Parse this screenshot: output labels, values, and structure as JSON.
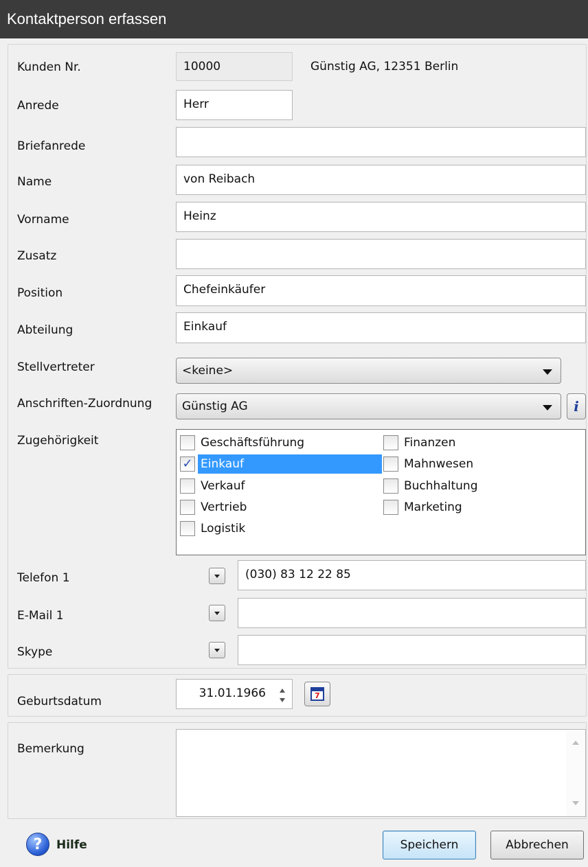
{
  "window": {
    "title": "Kontaktperson erfassen"
  },
  "form": {
    "kunden_nr": {
      "label": "Kunden Nr.",
      "value": "10000",
      "customer": "Günstig AG, 12351 Berlin"
    },
    "anrede": {
      "label": "Anrede",
      "value": "Herr"
    },
    "briefanrede": {
      "label": "Briefanrede",
      "value": ""
    },
    "name": {
      "label": "Name",
      "value": "von Reibach"
    },
    "vorname": {
      "label": "Vorname",
      "value": "Heinz"
    },
    "zusatz": {
      "label": "Zusatz",
      "value": ""
    },
    "position": {
      "label": "Position",
      "value": "Chefeinkäufer"
    },
    "abteilung": {
      "label": "Abteilung",
      "value": "Einkauf"
    },
    "stellvertreter": {
      "label": "Stellvertreter",
      "value": "<keine>"
    },
    "anschrift": {
      "label": "Anschriften-Zuordnung",
      "value": "Günstig AG"
    },
    "zugehoerigkeit": {
      "label": "Zugehörigkeit",
      "items": [
        {
          "label": "Geschäftsführung",
          "checked": false
        },
        {
          "label": "Einkauf",
          "checked": true,
          "check_mark": "✓"
        },
        {
          "label": "Verkauf",
          "checked": false
        },
        {
          "label": "Vertrieb",
          "checked": false
        },
        {
          "label": "Logistik",
          "checked": false
        },
        {
          "label": "Finanzen",
          "checked": false
        },
        {
          "label": "Mahnwesen",
          "checked": false
        },
        {
          "label": "Buchhaltung",
          "checked": false
        },
        {
          "label": "Marketing",
          "checked": false
        }
      ]
    },
    "telefon1": {
      "label": "Telefon 1",
      "value": "(030) 83 12 22 85"
    },
    "email1": {
      "label": "E-Mail 1",
      "value": ""
    },
    "skype": {
      "label": "Skype",
      "value": ""
    },
    "geburtsdatum": {
      "label": "Geburtsdatum",
      "value": "31.01.1966",
      "calendar_glyph": "7"
    },
    "bemerkung": {
      "label": "Bemerkung",
      "value": ""
    }
  },
  "footer": {
    "help_glyph": "?",
    "help_label": "Hilfe",
    "save_label": "Speichern",
    "cancel_label": "Abbrechen"
  },
  "icons": {
    "info": "i"
  },
  "colors": {
    "titlebar": "#3b3b3b",
    "selection": "#3399ff",
    "background": "#f0f0f0"
  }
}
